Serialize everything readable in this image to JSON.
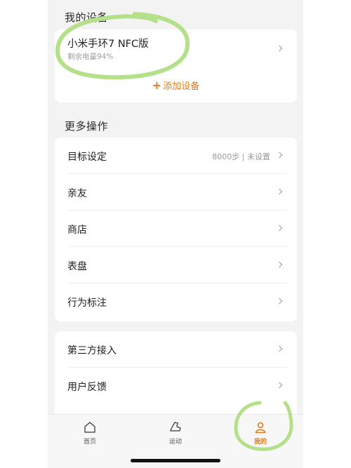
{
  "my_devices": {
    "title": "我的设备",
    "device": {
      "name": "小米手环7 NFC版",
      "battery": "剩余电量94%"
    },
    "add_label": "添加设备"
  },
  "more_actions": {
    "title": "更多操作",
    "items": [
      {
        "label": "目标设定",
        "value": "8000步 | 未设置"
      },
      {
        "label": "亲友"
      },
      {
        "label": "商店"
      },
      {
        "label": "表盘"
      },
      {
        "label": "行为标注"
      }
    ]
  },
  "other_items": [
    {
      "label": "第三方接入"
    },
    {
      "label": "用户反馈"
    }
  ],
  "tabbar": {
    "tabs": [
      {
        "label": "首页",
        "icon": "home-icon",
        "active": false
      },
      {
        "label": "运动",
        "icon": "shoe-icon",
        "active": false
      },
      {
        "label": "我的",
        "icon": "user-icon",
        "active": true
      }
    ]
  },
  "colors": {
    "accent": "#e07a16",
    "annotation": "#b5e08a",
    "background": "#f3f3f3"
  }
}
